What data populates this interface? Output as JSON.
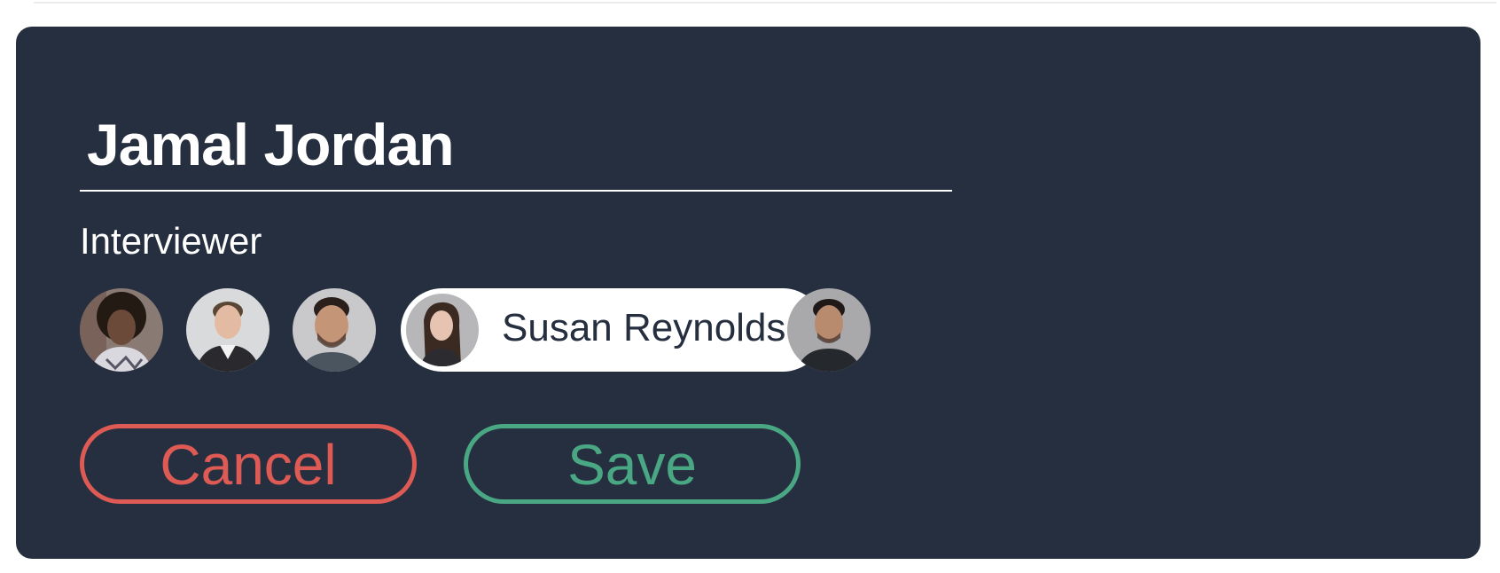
{
  "form": {
    "candidate_name": "Jamal Jordan",
    "interviewer_label": "Interviewer",
    "interviewers": [
      {
        "icon": "avatar-woman-curly-hair-icon",
        "skin": "#6b4a3a",
        "hair": "#241a14",
        "shirt": "#d8d8de",
        "bg": "#8a7a74"
      },
      {
        "icon": "avatar-man-short-hair-icon",
        "skin": "#e3bba3",
        "hair": "#5a4634",
        "shirt": "#2a2a2e",
        "bg": "#d9dadb"
      },
      {
        "icon": "avatar-man-beard-icon",
        "skin": "#c59578",
        "hair": "#2a1f1a",
        "shirt": "#4a5560",
        "bg": "#c9c9cc"
      },
      {
        "icon": "avatar-woman-long-hair-icon",
        "skin": "#e7c4b1",
        "hair": "#3a2a22",
        "shirt": "#2c2c30",
        "bg": "#b7b6b8"
      },
      {
        "icon": "avatar-man-dark-hair-icon",
        "skin": "#b88a6e",
        "hair": "#1f1a17",
        "shirt": "#25292d",
        "bg": "#a9a9ab"
      }
    ],
    "selected_interviewer": "Susan Reynolds",
    "cancel_label": "Cancel",
    "save_label": "Save"
  },
  "colors": {
    "card_bg": "#262f3f",
    "cancel": "#de5a54",
    "save": "#49a784",
    "text": "#ffffff"
  }
}
